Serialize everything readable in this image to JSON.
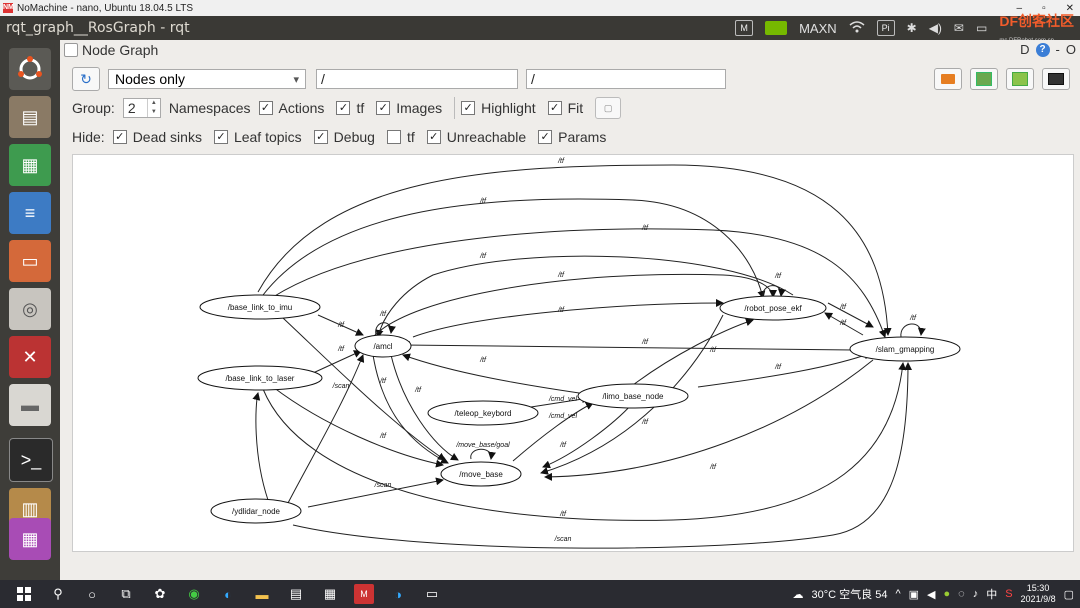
{
  "nomachine": {
    "title": "NoMachine - nano, Ubuntu 18.04.5 LTS",
    "logo": "NM",
    "controls": [
      "–",
      "▫",
      "✕"
    ]
  },
  "topbar": {
    "app_title": "rqt_graph__RosGraph - rqt",
    "maxn": "MAXN",
    "brand": "DF创客社区",
    "brand_sub": "mc.DFRobot.com.cn",
    "bluetooth": "✱",
    "volume": "◀)",
    "pi": "Pi"
  },
  "panel": {
    "title": "Node Graph",
    "controls_d": "D",
    "controls_help": "?",
    "controls_o": "O"
  },
  "toolbar": {
    "refresh_icon": "↻",
    "mode_selected": "Nodes only",
    "mode_arrow": "▾",
    "ns_filter": "/",
    "topic_filter": "/"
  },
  "options": {
    "group_label": "Group:",
    "group_value": "2",
    "namespaces_label": "Namespaces",
    "actions_label": "Actions",
    "actions_checked": true,
    "tf_label": "tf",
    "tf_checked": true,
    "images_label": "Images",
    "images_checked": true,
    "highlight_label": "Highlight",
    "highlight_checked": true,
    "fit_label": "Fit",
    "fit_checked": true
  },
  "hide": {
    "label": "Hide:",
    "dead_sinks": "Dead sinks",
    "leaf_topics": "Leaf topics",
    "debug": "Debug",
    "tf": "tf",
    "unreachable": "Unreachable",
    "params": "Params",
    "check": "✓"
  },
  "graph": {
    "nodes": {
      "base_link_to_imu": "/base_link_to_imu",
      "base_link_to_laser": "/base_link_to_laser",
      "amcl": "/amcl",
      "robot_pose_ekf": "/robot_pose_ekf",
      "slam_gmapping": "/slam_gmapping",
      "teleop_keybord": "/teleop_keybord",
      "limo_base_node": "/limo_base_node",
      "move_base": "/move_base",
      "ydlidar_node": "/ydlidar_node"
    },
    "topics": {
      "tf": "/tf",
      "scan": "/scan",
      "cmd_vel": "/cmd_vel",
      "move_base_goal": "/move_base/goal"
    }
  },
  "taskbar": {
    "weather": "30°C 空气良 54",
    "time": "15:30",
    "date": "2021/9/8",
    "lang": "中",
    "chevron": "^"
  }
}
